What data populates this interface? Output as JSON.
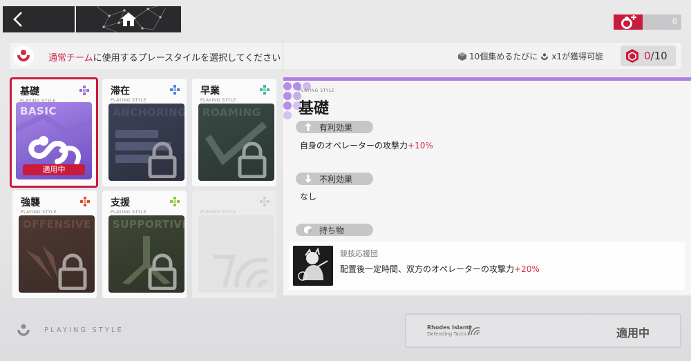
{
  "colors": {
    "accent": "#c91c3c",
    "purple": "#b07ee0"
  },
  "topbar": {
    "currency_value": "0"
  },
  "info": {
    "prompt_highlight": "通常チーム",
    "prompt_rest": "に使用するプレースタイルを選択してください",
    "collect_pre": "10個集めるたびに",
    "collect_post": "x1が獲得可能",
    "counter_current": "0",
    "counter_total": "/10"
  },
  "cards": [
    {
      "name": "基礎",
      "sub": "PLAYING STYLE",
      "art_label": "BASIC",
      "status": "適用中",
      "tag_color": "#9b6fd6"
    },
    {
      "name": "滞在",
      "sub": "PLAYING STYLE",
      "art_label": "ANCHORING",
      "tag_color": "#4f7fe0"
    },
    {
      "name": "早業",
      "sub": "PLAYING STYLE",
      "art_label": "ROAMING",
      "tag_color": "#3fb8a0"
    },
    {
      "name": "強襲",
      "sub": "PLAYING STYLE",
      "art_label": "OFFENSIVE",
      "tag_color": "#e24a2a"
    },
    {
      "name": "支援",
      "sub": "PLAYING STYLE",
      "art_label": "SUPPORTIVE",
      "tag_color": "#8cc83a"
    },
    {
      "name": "",
      "sub": "PLAYING STYLE",
      "art_label": "",
      "tag_color": "#cfcfd1"
    }
  ],
  "detail": {
    "small_label": "PLAYING STYLE",
    "title": "基礎",
    "advantage_label": "有利効果",
    "advantage_text": "自身のオペレーターの攻撃力",
    "advantage_value": "+10%",
    "disadvantage_label": "不利効果",
    "disadvantage_text": "なし",
    "item_label": "持ち物",
    "item_name": "競技応援団",
    "item_desc": "配置後一定時間、双方のオペレーターの攻撃力",
    "item_value": "+20%"
  },
  "bottom": {
    "label": "PLAYING STYLE",
    "brand_line1": "Rhodes Island",
    "brand_line2": "Defending Tactics",
    "apply_label": "適用中"
  }
}
